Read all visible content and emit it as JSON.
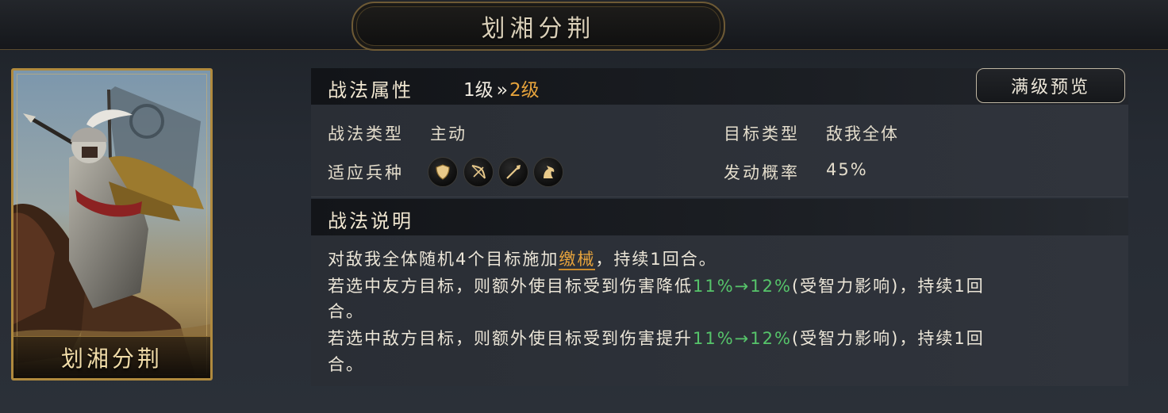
{
  "title": "划湘分荆",
  "card": {
    "name": "划湘分荆"
  },
  "attributes": {
    "section_label": "战法属性",
    "level_from": "1级",
    "level_arrow": "››",
    "level_to": "2级",
    "max_preview_button": "满级预览",
    "type_label": "战法类型",
    "type_value": "主动",
    "target_label": "目标类型",
    "target_value": "敌我全体",
    "troops_label": "适应兵种",
    "troops": [
      "shield-icon",
      "bow-icon",
      "spear-icon",
      "horse-icon"
    ],
    "chance_label": "发动概率",
    "chance_value": "45%"
  },
  "description": {
    "section_label": "战法说明",
    "line1_pre": "对敌我全体随机4个目标施加",
    "line1_effect": "缴械",
    "line1_post": "，持续1回合。",
    "line2_pre": "若选中友方目标，则额外使目标受到伤害降低",
    "line2_value": "11%→12%",
    "line2_post": "(受智力影响)，持续1回",
    "line2_cont": "合。",
    "line3_pre": "若选中敌方目标，则额外使目标受到伤害提升",
    "line3_value": "11%→12%",
    "line3_post": "(受智力影响)，持续1回",
    "line3_cont": "合。"
  },
  "colors": {
    "accent_orange": "#e6a33c",
    "value_green": "#56c46a",
    "card_border": "#b08a3e"
  }
}
